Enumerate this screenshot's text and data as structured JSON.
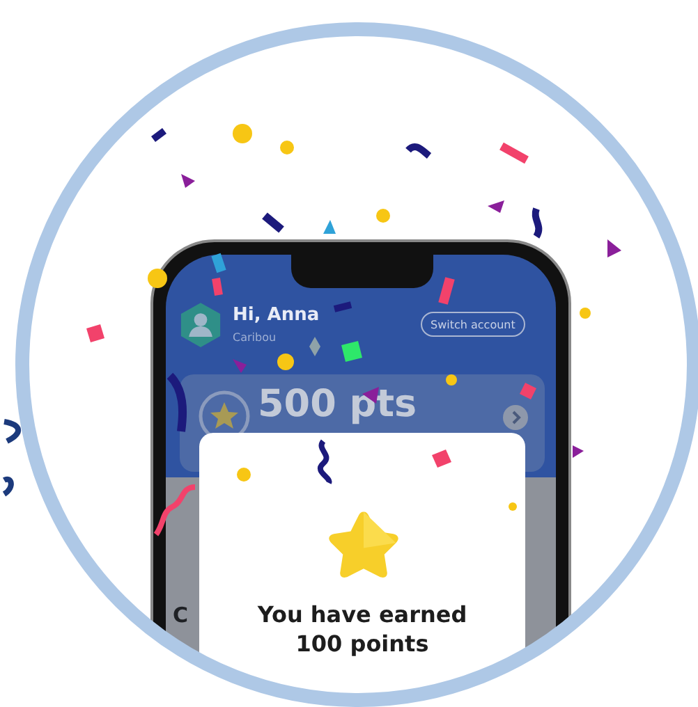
{
  "header": {
    "greeting": "Hi, Anna",
    "subtitle": "Caribou",
    "switch_button": "Switch account"
  },
  "points_card": {
    "points": "500 pts"
  },
  "section_heading": "C",
  "reward_dialog": {
    "message_lines": [
      "You have earned",
      "100 points"
    ]
  }
}
